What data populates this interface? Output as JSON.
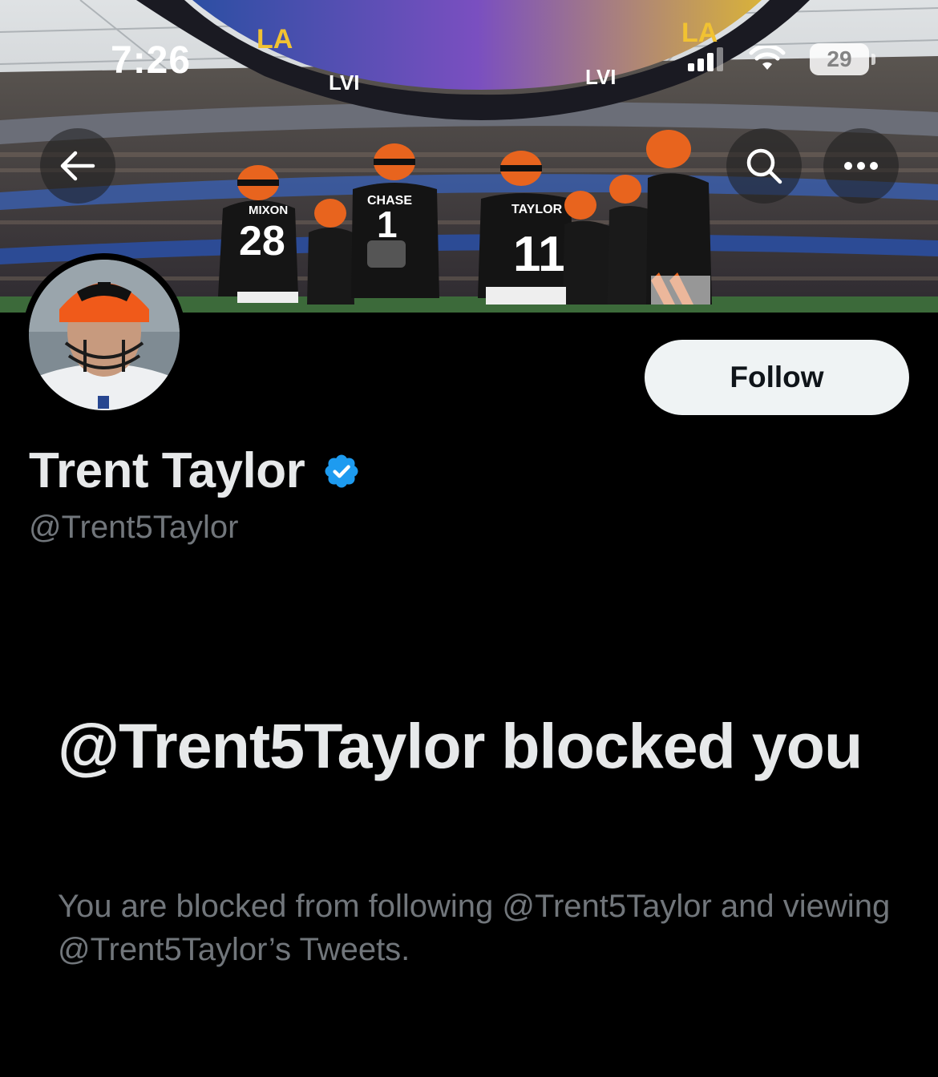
{
  "status_bar": {
    "time": "7:26",
    "battery": "29"
  },
  "banner": {
    "jersey_names": [
      "MIXON",
      "CHASE",
      "TAYLOR"
    ],
    "jersey_numbers": [
      "28",
      "1",
      "11"
    ],
    "stadium_text": [
      "LA",
      "LVI"
    ]
  },
  "header": {
    "back_icon": "arrow-left-icon",
    "search_icon": "search-icon",
    "more_icon": "more-horizontal-icon"
  },
  "profile": {
    "follow_label": "Follow",
    "display_name": "Trent Taylor",
    "verified_icon": "verified-badge-icon",
    "verified_color": "#1d9bf0",
    "handle": "@Trent5Taylor"
  },
  "blocked": {
    "title": "@Trent5Taylor blocked you",
    "description": "You are blocked from following @Trent5Taylor and viewing @Trent5Taylor’s Tweets."
  }
}
